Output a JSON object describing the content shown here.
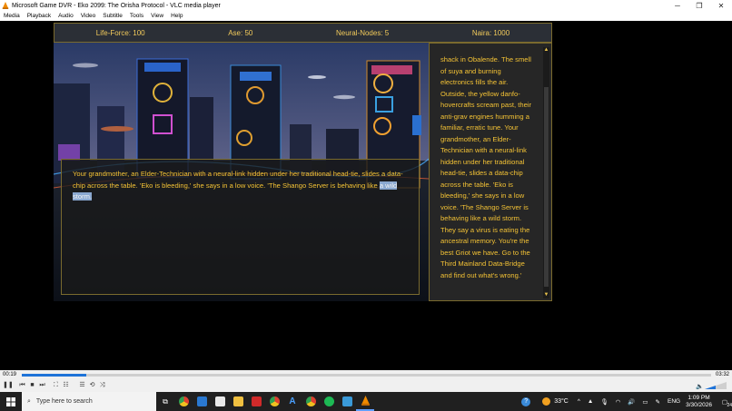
{
  "window": {
    "title": "Microsoft Game DVR - Eko 2099: The Orisha Protocol - VLC media player",
    "minimize_icon": "minimize-icon",
    "maximize_icon": "maximize-icon",
    "close_icon": "close-icon"
  },
  "menu": [
    "Media",
    "Playback",
    "Audio",
    "Video",
    "Subtitle",
    "Tools",
    "View",
    "Help"
  ],
  "hud": {
    "life_force": "Life-Force: 100",
    "ase": "Ase: 50",
    "neural_nodes": "Neural-Nodes: 5",
    "naira": "Naira: 1000"
  },
  "dialog": {
    "text_before": "Your grandmother, an Elder-Technician with a neural-link hidden under her traditional head-tie, slides a data-chip across the table. 'Eko is bleeding,' she says in a low voice. 'The Shango Server is behaving like ",
    "text_highlight": "a wild storm."
  },
  "sidepanel": {
    "text": "shack in Obalende. The smell of suya and burning electronics fills the air. Outside, the yellow danfo-hovercrafts scream past, their anti-grav engines humming a familiar, erratic tune. Your grandmother, an Elder-Technician with a neural-link hidden under her traditional head-tie, slides a data-chip across the table. 'Eko is bleeding,' she says in a low voice. 'The Shango Server is behaving like a wild storm. They say a virus is eating the ancestral memory. You're the best Griot we have. Go to the Third Mainland Data-Bridge and find out what's wrong.'"
  },
  "player": {
    "elapsed": "00:19",
    "total": "03:32",
    "progress": 0.094
  },
  "taskbar": {
    "search_placeholder": "Type here to search",
    "temperature": "33°C",
    "language": "ENG",
    "time": "1:09 PM",
    "date": "3/30/2026",
    "notifications": "24"
  },
  "colors": {
    "accent_gold": "#f3c235",
    "vlc_orange": "#f08a00",
    "seek_blue": "#1e73d8"
  }
}
